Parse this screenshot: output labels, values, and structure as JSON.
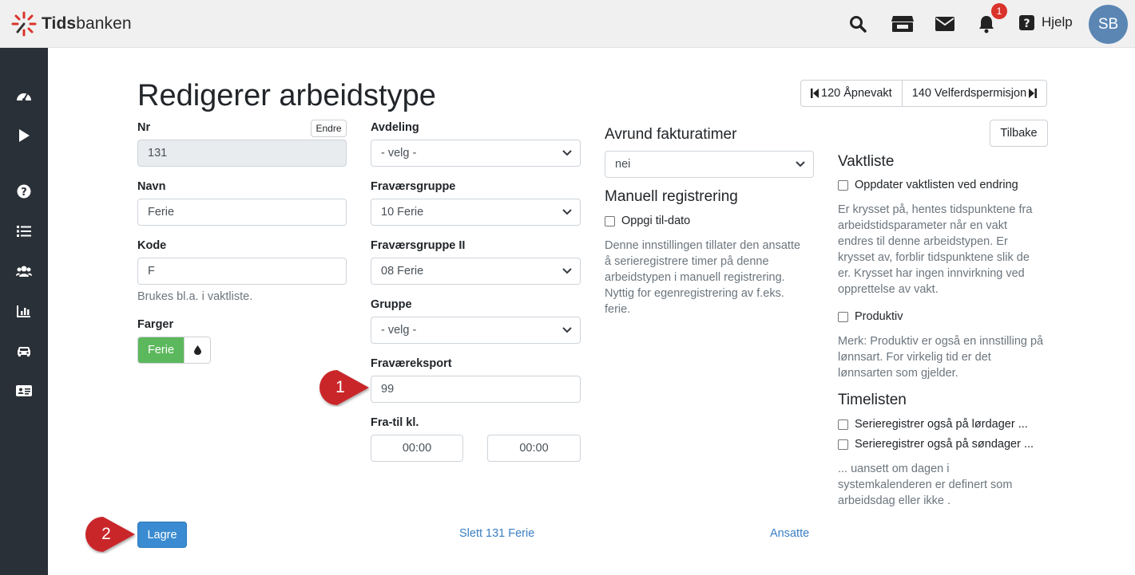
{
  "brand": {
    "name_bold": "Tids",
    "name_rest": "banken",
    "accent": "#d9332b"
  },
  "topbar": {
    "icons": [
      "search-icon",
      "store-icon",
      "envelope-icon",
      "bell-icon"
    ],
    "notification_count": "1",
    "help_label": "Hjelp",
    "avatar_initials": "SB"
  },
  "sidebar": {
    "icons": [
      "dashboard-icon",
      "play-icon",
      "question-circle-icon",
      "list-icon",
      "users-icon",
      "chart-icon",
      "car-icon",
      "id-card-icon"
    ]
  },
  "page": {
    "title": "Redigerer arbeidstype",
    "prev_label": "120 Åpnevakt",
    "next_label": "140 Velferdspermisjon",
    "back_label": "Tilbake"
  },
  "form": {
    "nr": {
      "label": "Nr",
      "edit_label": "Endre",
      "value": "131"
    },
    "navn": {
      "label": "Navn",
      "value": "Ferie"
    },
    "kode": {
      "label": "Kode",
      "value": "F",
      "help": "Brukes bl.a. i vaktliste."
    },
    "farger": {
      "label": "Farger",
      "swatch_label": "Ferie",
      "swatch_color": "#5cb85c"
    },
    "avdeling": {
      "label": "Avdeling",
      "value": "- velg -"
    },
    "fravaersgruppe": {
      "label": "Fraværsgruppe",
      "value": "10 Ferie"
    },
    "fravaersgruppe2": {
      "label": "Fraværsgruppe II",
      "value": "08 Ferie"
    },
    "gruppe": {
      "label": "Gruppe",
      "value": "- velg -"
    },
    "fravaereksport": {
      "label": "Fraværeksport",
      "value": "99"
    },
    "fratil": {
      "label": "Fra-til kl.",
      "from": "00:00",
      "to": "00:00"
    },
    "avrund": {
      "label": "Avrund fakturatimer",
      "value": "nei"
    },
    "manuell": {
      "label": "Manuell registrering",
      "checkbox": "Oppgi til-dato",
      "help": [
        "Denne innstillingen tillater den ansatte",
        "å serieregistrere timer på denne",
        "arbeidstypen i manuell registrering.",
        "Nyttig for egenregistrering av f.eks.",
        "ferie."
      ]
    },
    "vaktliste": {
      "label": "Vaktliste",
      "checkbox": "Oppdater vaktlisten ved endring",
      "help": [
        "Er krysset på, hentes tidspunktene fra",
        "arbeidstidsparameter når en vakt",
        "endres til denne arbeidstypen. Er",
        "krysset av, forblir tidspunktene slik de",
        "er. Krysset har ingen innvirkning ved",
        "opprettelse av vakt."
      ],
      "produktiv": "Produktiv",
      "produktiv_help": [
        "Merk: Produktiv er også en innstilling på",
        "lønnsart. For virkelig tid er det",
        "lønnsarten som gjelder."
      ]
    },
    "timelisten": {
      "label": "Timelisten",
      "checkbox_lordag": "Serieregistrer også på lørdager ...",
      "checkbox_sondag": "Serieregistrer også på søndager ...",
      "help": [
        "... uansett om dagen i",
        "systemkalenderen er definert som",
        "arbeidsdag eller ikke ."
      ]
    }
  },
  "actions": {
    "save": "Lagre",
    "delete": "Slett 131 Ferie",
    "employees": "Ansatte"
  },
  "markers": [
    "1",
    "2"
  ]
}
